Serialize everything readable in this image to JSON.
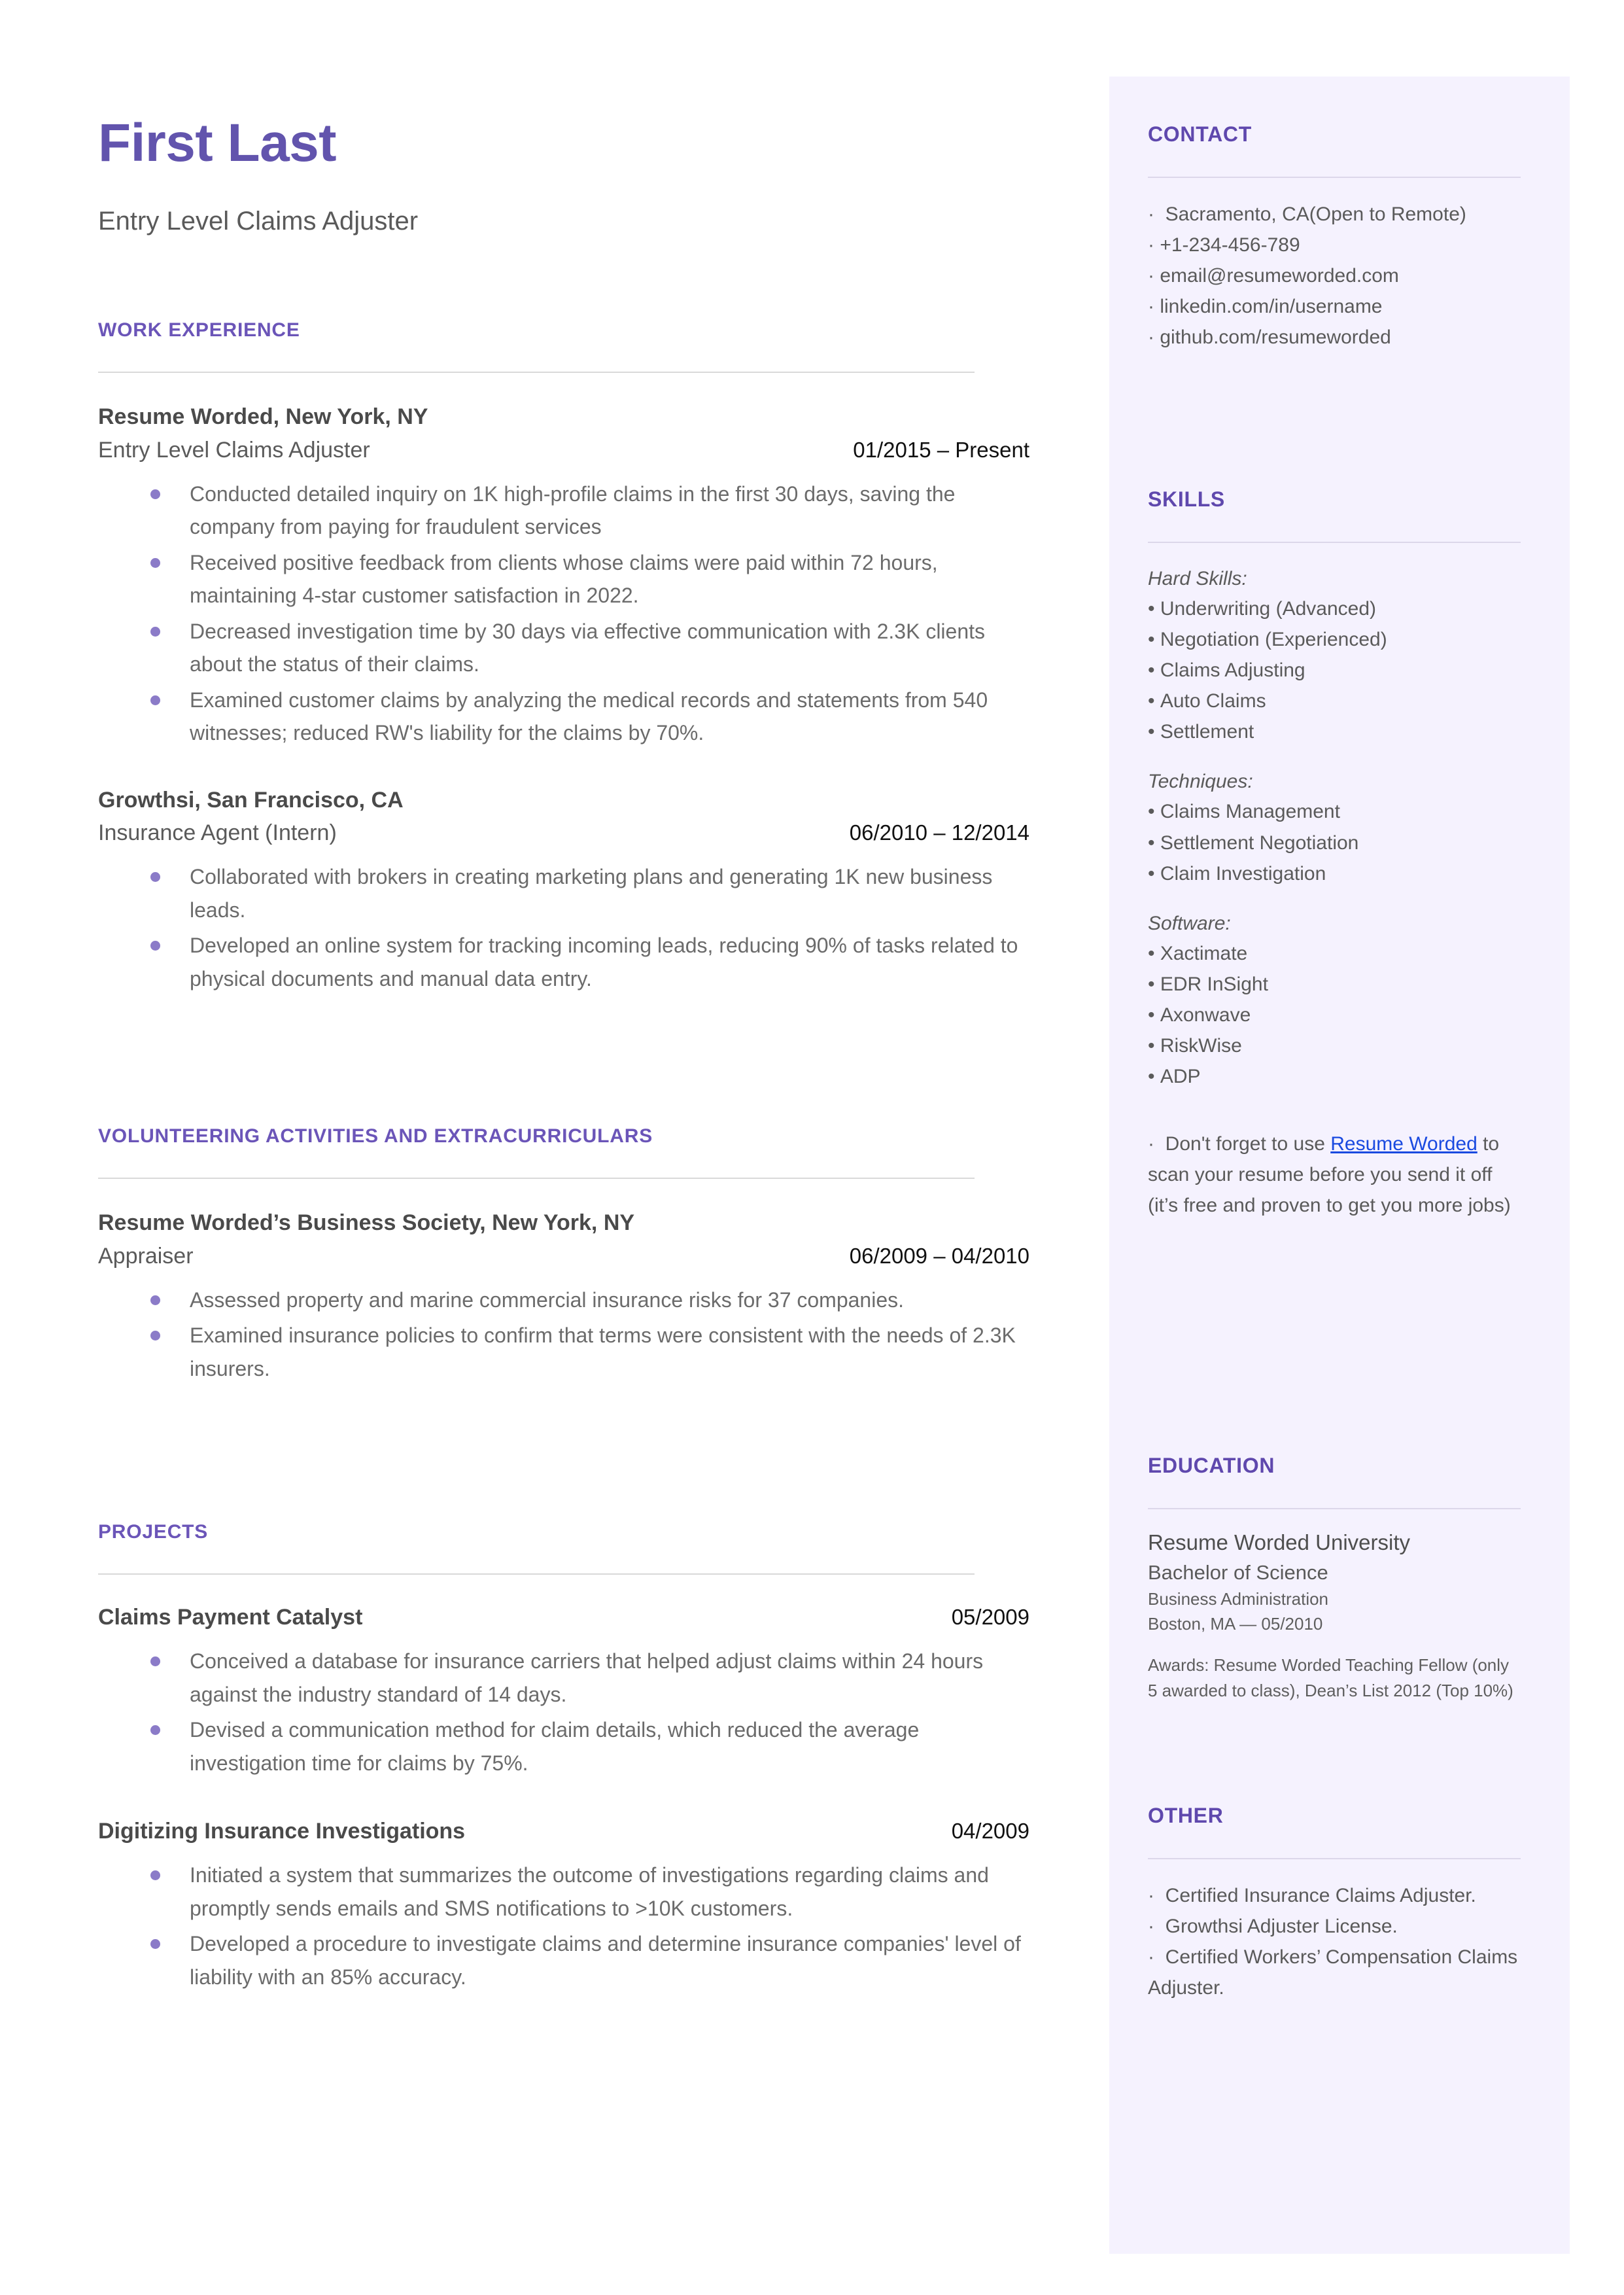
{
  "colors": {
    "name_purple": "#6254ad",
    "section_purple": "#6b55b8",
    "sidebar_bg": "#f5f2fe",
    "bullet_purple": "#8b7bc8",
    "link_blue": "#1a4ae0",
    "body_gray": "#6b6b6b",
    "rule_gray": "#d9d9d9"
  },
  "header": {
    "name": "First Last",
    "headline": "Entry Level Claims Adjuster"
  },
  "sections": {
    "work_experience": {
      "title": "WORK EXPERIENCE",
      "entries": [
        {
          "org": "Resume Worded, New York, NY",
          "role": "Entry Level Claims Adjuster",
          "date": "01/2015 – Present",
          "bullets": [
            "Conducted detailed inquiry on 1K high-profile claims in the first 30 days, saving the company from paying for fraudulent services",
            "Received positive feedback from clients whose claims were paid within 72 hours, maintaining 4-star customer satisfaction in 2022.",
            "Decreased investigation time by 30 days via effective communication with 2.3K clients about the status of their claims.",
            "Examined customer claims by analyzing the medical records and statements from 540 witnesses; reduced RW's liability for the claims by 70%."
          ]
        },
        {
          "org": "Growthsi, San Francisco, CA",
          "role": "Insurance Agent (Intern)",
          "date": "06/2010 – 12/2014",
          "bullets": [
            "Collaborated with brokers in creating marketing plans and generating 1K new business leads.",
            "Developed an online system for tracking incoming leads, reducing 90% of tasks related to physical documents and manual data entry."
          ]
        }
      ]
    },
    "volunteering": {
      "title": "VOLUNTEERING ACTIVITIES AND EXTRACURRICULARS",
      "entries": [
        {
          "org": "Resume Worded’s Business Society, New York, NY",
          "role": "Appraiser",
          "date": "06/2009 – 04/2010",
          "bullets": [
            "Assessed property and marine commercial insurance risks for 37 companies.",
            "Examined insurance policies to confirm that terms were consistent with the needs of 2.3K insurers."
          ]
        }
      ]
    },
    "projects": {
      "title": "PROJECTS",
      "entries": [
        {
          "name": "Claims Payment Catalyst",
          "date": "05/2009",
          "bullets": [
            "Conceived a database for insurance carriers that helped adjust claims within 24 hours against the industry standard of 14 days.",
            "Devised a communication method for claim details, which reduced the average investigation time for claims by 75%."
          ]
        },
        {
          "name": "Digitizing Insurance Investigations",
          "date": "04/2009",
          "bullets": [
            "Initiated a system that summarizes the outcome of investigations regarding claims and promptly sends emails and SMS notifications to >10K customers.",
            "Developed a procedure to investigate claims and determine insurance companies' level of liability with an 85% accuracy."
          ]
        }
      ]
    }
  },
  "sidebar": {
    "contact": {
      "title": "CONTACT",
      "items": [
        "Sacramento, CA(Open to Remote)",
        "+1-234-456-789",
        "email@resumeworded.com",
        "linkedin.com/in/username",
        "github.com/resumeworded"
      ]
    },
    "skills": {
      "title": "SKILLS",
      "groups": [
        {
          "label": "Hard Skills:",
          "items": [
            "Underwriting (Advanced)",
            "Negotiation (Experienced)",
            "Claims Adjusting",
            "Auto Claims",
            "Settlement"
          ]
        },
        {
          "label": "Techniques:",
          "items": [
            "Claims Management",
            "Settlement Negotiation",
            "Claim Investigation"
          ]
        },
        {
          "label": "Software:",
          "items": [
            "Xactimate",
            "EDR InSight",
            "Axonwave",
            "RiskWise",
            "ADP"
          ]
        }
      ],
      "promo": {
        "prefix": "Don't forget to use ",
        "link": "Resume Worded",
        "suffix": " to scan your resume before you send it off (it’s free and proven to get you more jobs)"
      }
    },
    "education": {
      "title": "EDUCATION",
      "university": "Resume Worded University",
      "degree": "Bachelor of Science",
      "field": "Business Administration",
      "location_date": "Boston, MA — 05/2010",
      "awards": "Awards: Resume Worded Teaching Fellow (only 5 awarded to class), Dean’s List 2012 (Top 10%)"
    },
    "other": {
      "title": "OTHER",
      "items": [
        "Certified Insurance Claims Adjuster.",
        "Growthsi Adjuster License.",
        "Certified Workers’ Compensation Claims Adjuster."
      ]
    }
  }
}
